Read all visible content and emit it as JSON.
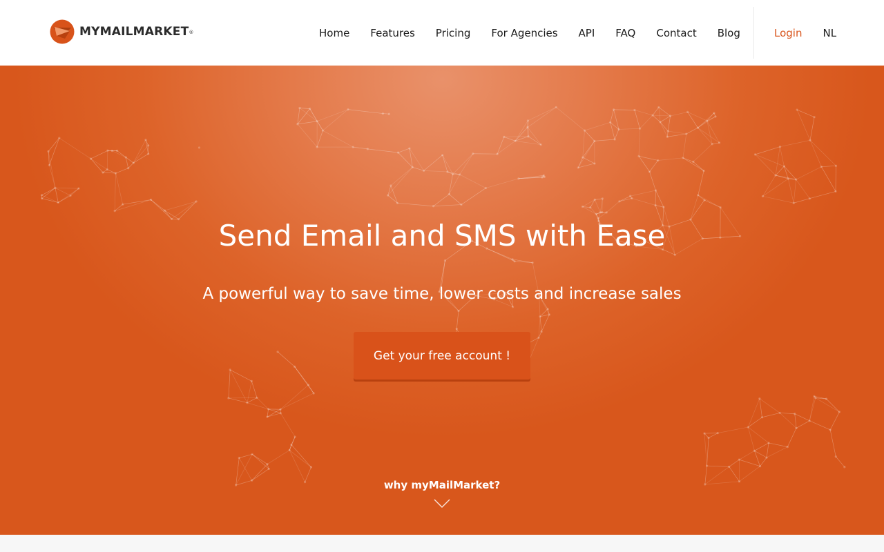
{
  "brand": {
    "name": "MYMAILMARKET",
    "trademark": "®"
  },
  "nav": {
    "items": [
      {
        "label": "Home"
      },
      {
        "label": "Features"
      },
      {
        "label": "Pricing"
      },
      {
        "label": "For Agencies"
      },
      {
        "label": "API"
      },
      {
        "label": "FAQ"
      },
      {
        "label": "Contact"
      },
      {
        "label": "Blog"
      }
    ],
    "login_label": "Login",
    "language_label": "NL"
  },
  "hero": {
    "title": "Send Email and SMS with Ease",
    "subtitle": "A powerful way to save time, lower costs and increase sales",
    "cta_label": "Get your free account !",
    "why_label": "why myMailMarket?",
    "scroll_icon": "chevron-down-icon",
    "background_graphic": "world-map-network-icon"
  },
  "colors": {
    "accent": "#d8531a",
    "hero_light": "#e9916a",
    "hero_dark": "#d8571c",
    "button": "#d9521a",
    "nav_text": "#1a1a1a"
  }
}
